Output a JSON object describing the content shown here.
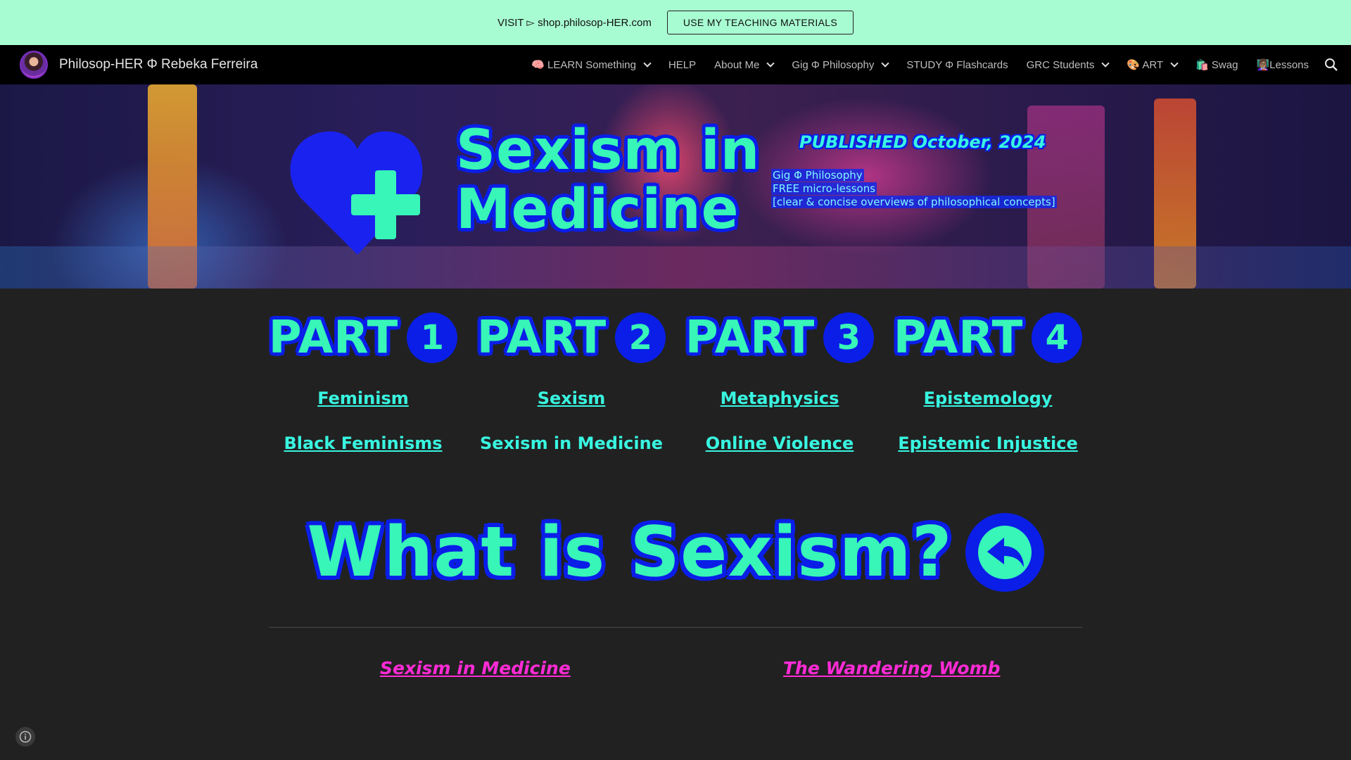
{
  "announcement": {
    "text": "VISIT ▻ shop.philosop-HER.com",
    "button_label": "USE MY TEACHING MATERIALS"
  },
  "nav": {
    "site_title": "Philosop-HER Φ Rebeka Ferreira",
    "items": [
      {
        "label": "🧠 LEARN Something",
        "has_dropdown": true
      },
      {
        "label": "HELP",
        "has_dropdown": false
      },
      {
        "label": "About Me",
        "has_dropdown": true
      },
      {
        "label": "Gig Φ Philosophy",
        "has_dropdown": true
      },
      {
        "label": "STUDY Φ Flashcards",
        "has_dropdown": false
      },
      {
        "label": "GRC Students",
        "has_dropdown": true
      },
      {
        "label": "🎨 ART",
        "has_dropdown": true
      },
      {
        "label": "🛍️ Swag",
        "has_dropdown": false
      },
      {
        "label": "👩🏽‍🏫Lessons",
        "has_dropdown": false
      }
    ],
    "search_icon": "search-icon"
  },
  "hero": {
    "title_line1": "Sexism in",
    "title_line2": "Medicine",
    "published": "PUBLISHED October, 2024",
    "lines": [
      "Gig Φ Philosophy",
      "FREE micro-lessons",
      "[clear & concise overviews of philosophical concepts]"
    ],
    "icon": "heart-medical-cross-icon"
  },
  "parts": [
    {
      "word": "PART",
      "num": "1",
      "link1": "Feminism",
      "link2": "Black Feminisms"
    },
    {
      "word": "PART",
      "num": "2",
      "link1": "Sexism",
      "link2": "Sexism in Medicine"
    },
    {
      "word": "PART",
      "num": "3",
      "link1": "Metaphysics",
      "link2": "Online Violence"
    },
    {
      "word": "PART",
      "num": "4",
      "link1": "Epistemology",
      "link2": "Epistemic Injustice"
    }
  ],
  "section": {
    "heading": "What is Sexism?",
    "back_icon": "back-arrow-icon"
  },
  "bottom_links": {
    "left": "Sexism in Medicine",
    "right": "The Wandering Womb"
  },
  "colors": {
    "accent_mint": "#38f5b8",
    "accent_blue": "#0a1ee8",
    "link_pink": "#ff2bd6",
    "announce_bg": "#a8fcd2"
  }
}
